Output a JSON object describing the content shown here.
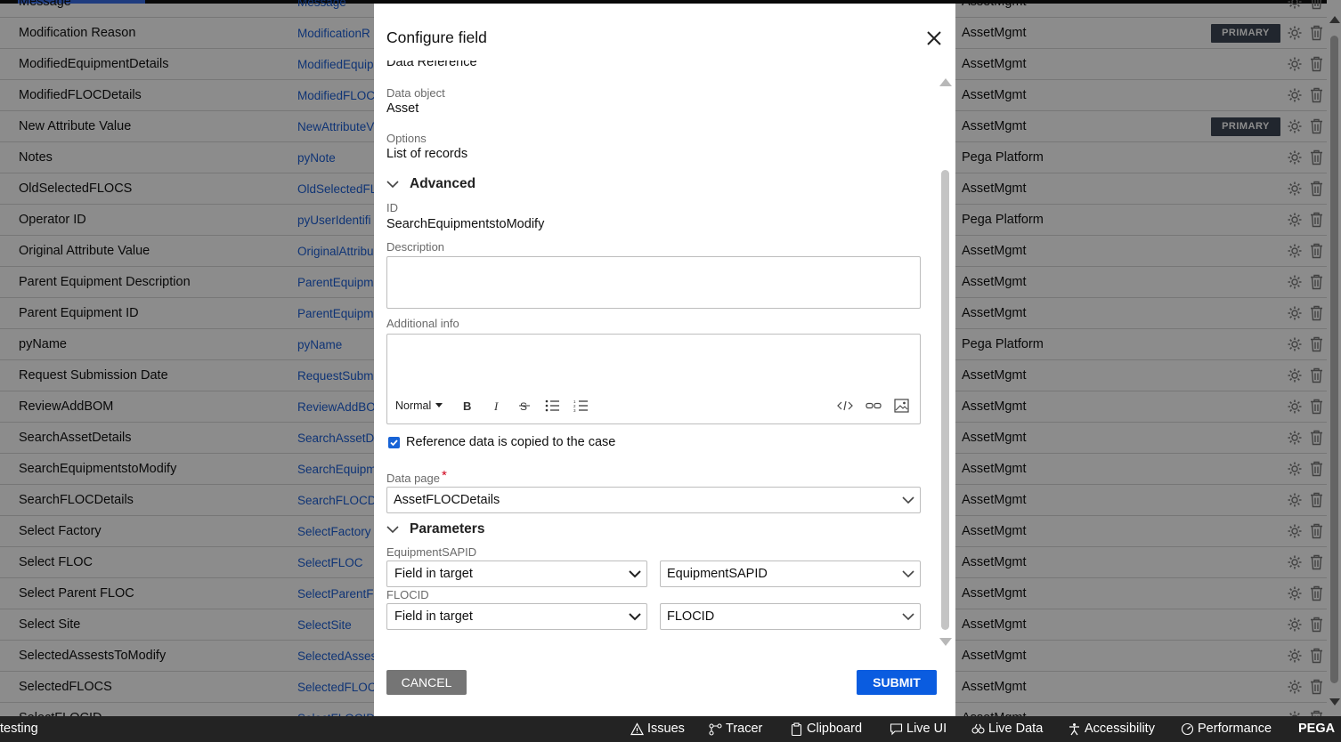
{
  "background_list": {
    "top_partial": {
      "label": "Message",
      "id": "Message",
      "source": "AssetMgmt"
    },
    "rows": [
      {
        "label": "Modification Reason",
        "id": "ModificationR",
        "source": "AssetMgmt",
        "badge": "PRIMARY"
      },
      {
        "label": "ModifiedEquipmentDetails",
        "id": "ModifiedEquip",
        "source": "AssetMgmt",
        "badge": ""
      },
      {
        "label": "ModifiedFLOCDetails",
        "id": "ModifiedFLOC",
        "source": "AssetMgmt",
        "badge": ""
      },
      {
        "label": "New Attribute Value",
        "id": "NewAttributeV",
        "source": "AssetMgmt",
        "badge": "PRIMARY"
      },
      {
        "label": "Notes",
        "id": "pyNote",
        "source": "Pega Platform",
        "badge": ""
      },
      {
        "label": "OldSelectedFLOCS",
        "id": "OldSelectedFL",
        "source": "AssetMgmt",
        "badge": ""
      },
      {
        "label": "Operator ID",
        "id": "pyUserIdentifi",
        "source": "Pega Platform",
        "badge": ""
      },
      {
        "label": "Original Attribute Value",
        "id": "OriginalAttribu",
        "source": "AssetMgmt",
        "badge": ""
      },
      {
        "label": "Parent Equipment Description",
        "id": "ParentEquipm",
        "source": "AssetMgmt",
        "badge": ""
      },
      {
        "label": "Parent Equipment ID",
        "id": "ParentEquipm",
        "source": "AssetMgmt",
        "badge": ""
      },
      {
        "label": "pyName",
        "id": "pyName",
        "source": "Pega Platform",
        "badge": ""
      },
      {
        "label": "Request Submission Date",
        "id": "RequestSubm",
        "source": "AssetMgmt",
        "badge": ""
      },
      {
        "label": "ReviewAddBOM",
        "id": "ReviewAddBO",
        "source": "AssetMgmt",
        "badge": ""
      },
      {
        "label": "SearchAssetDetails",
        "id": "SearchAssetDe",
        "source": "AssetMgmt",
        "badge": ""
      },
      {
        "label": "SearchEquipmentstoModify",
        "id": "SearchEquipm",
        "source": "AssetMgmt",
        "badge": ""
      },
      {
        "label": "SearchFLOCDetails",
        "id": "SearchFLOCDe",
        "source": "AssetMgmt",
        "badge": ""
      },
      {
        "label": "Select Factory",
        "id": "SelectFactory",
        "source": "AssetMgmt",
        "badge": ""
      },
      {
        "label": "Select FLOC",
        "id": "SelectFLOC",
        "source": "AssetMgmt",
        "badge": ""
      },
      {
        "label": "Select Parent FLOC",
        "id": "SelectParentFl",
        "source": "AssetMgmt",
        "badge": ""
      },
      {
        "label": "Select Site",
        "id": "SelectSite",
        "source": "AssetMgmt",
        "badge": ""
      },
      {
        "label": "SelectedAssestsToModify",
        "id": "SelectedAsses",
        "source": "AssetMgmt",
        "badge": ""
      },
      {
        "label": "SelectedFLOCS",
        "id": "SelectedFLOCS",
        "source": "AssetMgmt",
        "badge": ""
      }
    ],
    "bottom_partial": {
      "label": "SelectFLOCID",
      "id": "SelectFLOCID",
      "source": "AssetMgmt"
    }
  },
  "modal": {
    "title": "Configure field",
    "type_partial": "Data Reference",
    "data_object_label": "Data object",
    "data_object_value": "Asset",
    "options_label": "Options",
    "options_value": "List of records",
    "advanced_title": "Advanced",
    "id_label": "ID",
    "id_value": "SearchEquipmentstoModify",
    "description_label": "Description",
    "description_value": "",
    "additional_info_label": "Additional info",
    "editor_format": "Normal",
    "checkbox_label": "Reference data is copied to the case",
    "checkbox_checked": true,
    "data_page_label": "Data page",
    "required_mark": "*",
    "data_page_value": "AssetFLOCDetails",
    "parameters_title": "Parameters",
    "params": [
      {
        "name": "EquipmentSAPID",
        "mode": "Field in target",
        "value": "EquipmentSAPID"
      },
      {
        "name": "FLOCID",
        "mode": "Field in target",
        "value": "FLOCID"
      }
    ],
    "cancel_label": "CANCEL",
    "submit_label": "SUBMIT"
  },
  "devbar": {
    "left_label": "testing",
    "items": [
      "Issues",
      "Tracer",
      "Clipboard",
      "Live UI",
      "Live Data",
      "Accessibility",
      "Performance"
    ],
    "brand": "PEGA"
  },
  "colors": {
    "primary_button": "#0a5ce0",
    "badge": "#3d4654",
    "link": "#1d5fd6",
    "devbar": "#232323",
    "required": "#d0021b"
  }
}
